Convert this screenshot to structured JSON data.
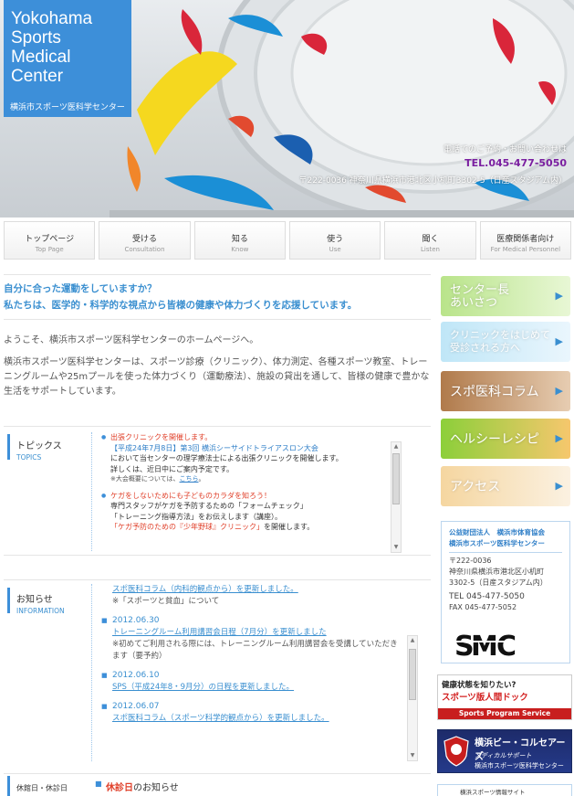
{
  "header": {
    "logo_title": "Yokohama\nSports\nMedical\nCenter",
    "logo_subtitle": "横浜市スポーツ医科学センター",
    "contact_label": "電話でのご予約・お問い合わせは",
    "tel": "TEL.045-477-5050",
    "address": "〒222-0036 神奈川県横浜市港北区小机町3302-5（日産スタジアム内）"
  },
  "nav": {
    "items": [
      {
        "jp": "トップページ",
        "en": "Top Page"
      },
      {
        "jp": "受ける",
        "en": "Consultation"
      },
      {
        "jp": "知る",
        "en": "Know"
      },
      {
        "jp": "使う",
        "en": "Use"
      },
      {
        "jp": "聞く",
        "en": "Listen"
      },
      {
        "jp": "医療関係者向け",
        "en": "For Medical Personnel"
      }
    ]
  },
  "main": {
    "lead_line1": "自分に合った運動をしていますか？",
    "lead_line2": "私たちは、医学的・科学的な視点から皆様の健康や体力づくりを応援しています。",
    "welcome": "ようこそ、横浜市スポーツ医科学センターのホームページへ。",
    "intro": "横浜市スポーツ医科学センターは、スポーツ診療（クリニック）、体力測定、各種スポーツ教室、トレーニングルームや25mプールを使った体力づくり（運動療法）、施設の貸出を通して、皆様の健康で豊かな生活をサポートしています。"
  },
  "topics": {
    "heading": "トピックス",
    "heading_en": "TOPICS",
    "item1": {
      "title": "出張クリニックを開催します。",
      "event": "【平成24年7月8日】第3回 横浜シーサイドトライアスロン大会",
      "desc": "において当センターの理学療法士による出張クリニックを開催します。",
      "detail": "詳しくは、近日中にご案内予定です。",
      "note_prefix": "※大会概要については、",
      "note_link": "こちら",
      "note_suffix": "。"
    },
    "item2": {
      "title": "ケガをしないためにも子どものカラダを知ろう！",
      "line1": "専門スタッフがケガを予防するための「フォームチェック」",
      "line2": "「トレーニング指導方法」をお伝えします（講座）。",
      "clinic": "「ケガ予防のための『少年野球』クリニック」",
      "suffix": "を開催します。"
    }
  },
  "info": {
    "heading": "お知らせ",
    "heading_en": "INFORMATION",
    "items": [
      {
        "date": "",
        "text": "スポ医科コラム（内科的観点から）を更新しました。",
        "sub": "※「スポーツと貧血」について"
      },
      {
        "date": "2012.06.30",
        "text": "トレーニングルーム利用講習会日程（7月分）を更新しました",
        "sub": "※初めてご利用される際には、トレーニングルーム利用講習会を受講していただきます（要予約）"
      },
      {
        "date": "2012.06.10",
        "text": "SPS（平成24年8・9月分）の日程を更新しました。",
        "sub": ""
      },
      {
        "date": "2012.06.07",
        "text": "スポ医科コラム（スポーツ科学的観点から）を更新しました。",
        "sub": ""
      }
    ]
  },
  "holiday": {
    "heading": "休館日・休診日",
    "title_highlight": "休診日",
    "title_rest": "のお知らせ"
  },
  "sidebar": {
    "buttons": [
      {
        "label": "センター長\nあいさつ"
      },
      {
        "label": "クリニックをはじめて\n受診される方へ"
      },
      {
        "label": "スポ医科コラム"
      },
      {
        "label": "ヘルシーレシピ"
      },
      {
        "label": "アクセス"
      }
    ],
    "card": {
      "org": "公益財団法人　横浜市体育協会\n横浜市スポーツ医科学センター",
      "postal": "〒222-0036",
      "address": "神奈川県横浜市港北区小机町3302-5（日産スタジアム内）",
      "tel": "TEL 045-477-5050",
      "fax": "FAX 045-477-5052"
    },
    "banner_dock": {
      "line1": "健康状態を知りたい?",
      "line2": "スポーツ版人間ドック",
      "line3": "Sports Program Service"
    },
    "banner_bay": {
      "line1": "横浜ビー・コルセアーズ",
      "line2": "メディカルサポート",
      "line3": "横浜市スポーツ医科学センター"
    },
    "banner_info": "横浜スポーツ情報サイト"
  }
}
